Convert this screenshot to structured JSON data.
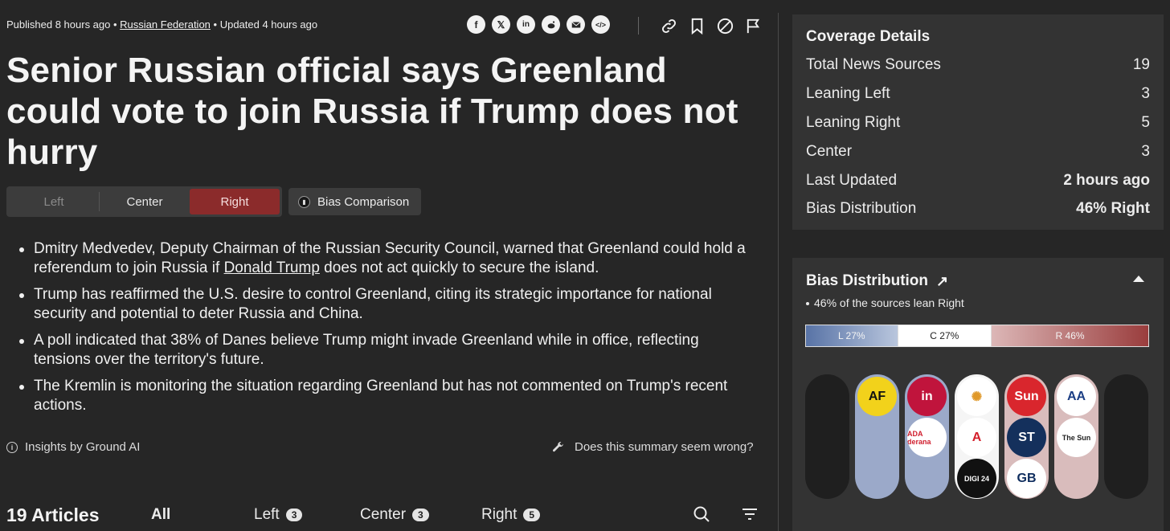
{
  "meta": {
    "published": "Published 8 hours ago •",
    "location": "Russian Federation",
    "updated": "• Updated 4 hours ago"
  },
  "share_icons": [
    "facebook-icon",
    "x-icon",
    "linkedin-icon",
    "reddit-icon",
    "email-icon",
    "embed-icon"
  ],
  "tool_icons": [
    "link-icon",
    "bookmark-icon",
    "block-icon",
    "flag-icon"
  ],
  "title": "Senior Russian official says Greenland could vote to join Russia if Trump does not hurry",
  "perspective_tabs": {
    "left": "Left",
    "center": "Center",
    "right": "Right",
    "active": "Right"
  },
  "bias_comparison_label": "Bias Comparison",
  "summary": [
    {
      "before": "Dmitry Medvedev, Deputy Chairman of the Russian Security Council, warned that Greenland could hold a referendum to join Russia if ",
      "link": "Donald Trump",
      "after": " does not act quickly to secure the island."
    },
    {
      "text": "Trump has reaffirmed the U.S. desire to control Greenland, citing its strategic importance for national security and potential to deter Russia and China."
    },
    {
      "text": "A poll indicated that 38% of Danes believe Trump might invade Greenland while in office, reflecting tensions over the territory's future."
    },
    {
      "text": "The Kremlin is monitoring the situation regarding Greenland but has not commented on Trump's recent actions."
    }
  ],
  "insights_label": "Insights by Ground AI",
  "wrong_label": "Does this summary seem wrong?",
  "articles": {
    "count_label": "19 Articles",
    "tabs": [
      {
        "label": "All",
        "count": null
      },
      {
        "label": "Left",
        "count": "3"
      },
      {
        "label": "Center",
        "count": "3"
      },
      {
        "label": "Right",
        "count": "5"
      }
    ]
  },
  "coverage": {
    "title": "Coverage Details",
    "rows": [
      {
        "label": "Total News Sources",
        "value": "19"
      },
      {
        "label": "Leaning Left",
        "value": "3"
      },
      {
        "label": "Leaning Right",
        "value": "5"
      },
      {
        "label": "Center",
        "value": "3"
      },
      {
        "label": "Last Updated",
        "value": "2 hours ago"
      },
      {
        "label": "Bias Distribution",
        "value": "46% Right"
      }
    ]
  },
  "bias_distribution": {
    "title": "Bias Distribution",
    "note": "46% of the sources lean Right",
    "bar": [
      {
        "label": "L 27%",
        "pct": 27
      },
      {
        "label": "C 27%",
        "pct": 27
      },
      {
        "label": "R 46%",
        "pct": 46
      }
    ],
    "columns": [
      {
        "lean": "empty",
        "logos": []
      },
      {
        "lean": "left",
        "logos": [
          {
            "text": "AF",
            "bg": "#f2d21b",
            "fg": "#111"
          }
        ]
      },
      {
        "lean": "left",
        "logos": [
          {
            "text": "in",
            "bg": "#c0143c",
            "fg": "#fff"
          },
          {
            "text": "ADA derana",
            "bg": "#ffffff",
            "fg": "#d01e2e"
          }
        ]
      },
      {
        "lean": "center",
        "logos": [
          {
            "text": "✺",
            "bg": "#ffffff",
            "fg": "#e0992a"
          },
          {
            "text": "A",
            "bg": "#ffffff",
            "fg": "#d4202c"
          },
          {
            "text": "DIGI 24",
            "bg": "#111111",
            "fg": "#fff"
          }
        ]
      },
      {
        "lean": "right",
        "logos": [
          {
            "text": "Sun",
            "bg": "#d9262d",
            "fg": "#fff"
          },
          {
            "text": "ST",
            "bg": "#14305c",
            "fg": "#fff"
          },
          {
            "text": "GB",
            "bg": "#ffffff",
            "fg": "#0f2d5e"
          }
        ]
      },
      {
        "lean": "right",
        "logos": [
          {
            "text": "AA",
            "bg": "#ffffff",
            "fg": "#1b3e84"
          },
          {
            "text": "The Sun",
            "bg": "#ffffff",
            "fg": "#222"
          }
        ]
      },
      {
        "lean": "empty",
        "logos": []
      }
    ]
  },
  "colors": {
    "background": "#262626",
    "card": "#333333",
    "right_accent": "#8b2b2b",
    "left_accent": "#5873a6"
  }
}
